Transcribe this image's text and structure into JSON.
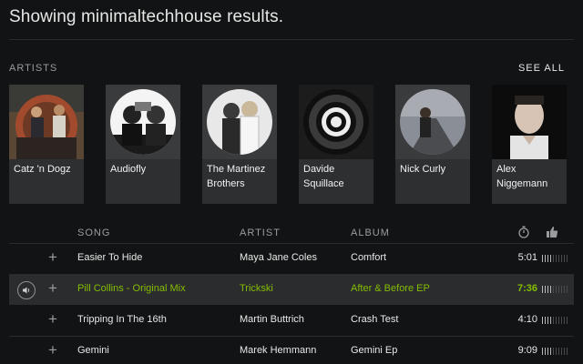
{
  "header": {
    "title": "Showing minimaltechhouse results."
  },
  "artists": {
    "label": "ARTISTS",
    "see_all": "SEE ALL",
    "items": [
      {
        "name": "Catz 'n Dogz"
      },
      {
        "name": "Audiofly"
      },
      {
        "name": "The Martinez Brothers"
      },
      {
        "name": "Davide Squillace"
      },
      {
        "name": "Nick Curly"
      },
      {
        "name": "Alex Niggemann"
      }
    ]
  },
  "songs": {
    "columns": {
      "song": "SONG",
      "artist": "ARTIST",
      "album": "ALBUM"
    },
    "header_icons": [
      "stopwatch-icon",
      "thumbs-up-icon"
    ],
    "rows": [
      {
        "song": "Easier To Hide",
        "artist": "Maya Jane Coles",
        "album": "Comfort",
        "duration": "5:01",
        "popularity": 0.4
      },
      {
        "song": "Pill Collins - Original Mix",
        "artist": "Trickski",
        "album": "After & Before EP",
        "duration": "7:36",
        "popularity": 0.35,
        "playing": true
      },
      {
        "song": "Tripping In The 16th",
        "artist": "Martin Buttrich",
        "album": "Crash Test",
        "duration": "4:10",
        "popularity": 0.35
      },
      {
        "song": "Gemini",
        "artist": "Marek Hemmann",
        "album": "Gemini Ep",
        "duration": "9:09",
        "popularity": 0.35
      }
    ]
  },
  "colors": {
    "accent": "#84bd00",
    "background": "#121314",
    "card": "#2e2f31"
  }
}
